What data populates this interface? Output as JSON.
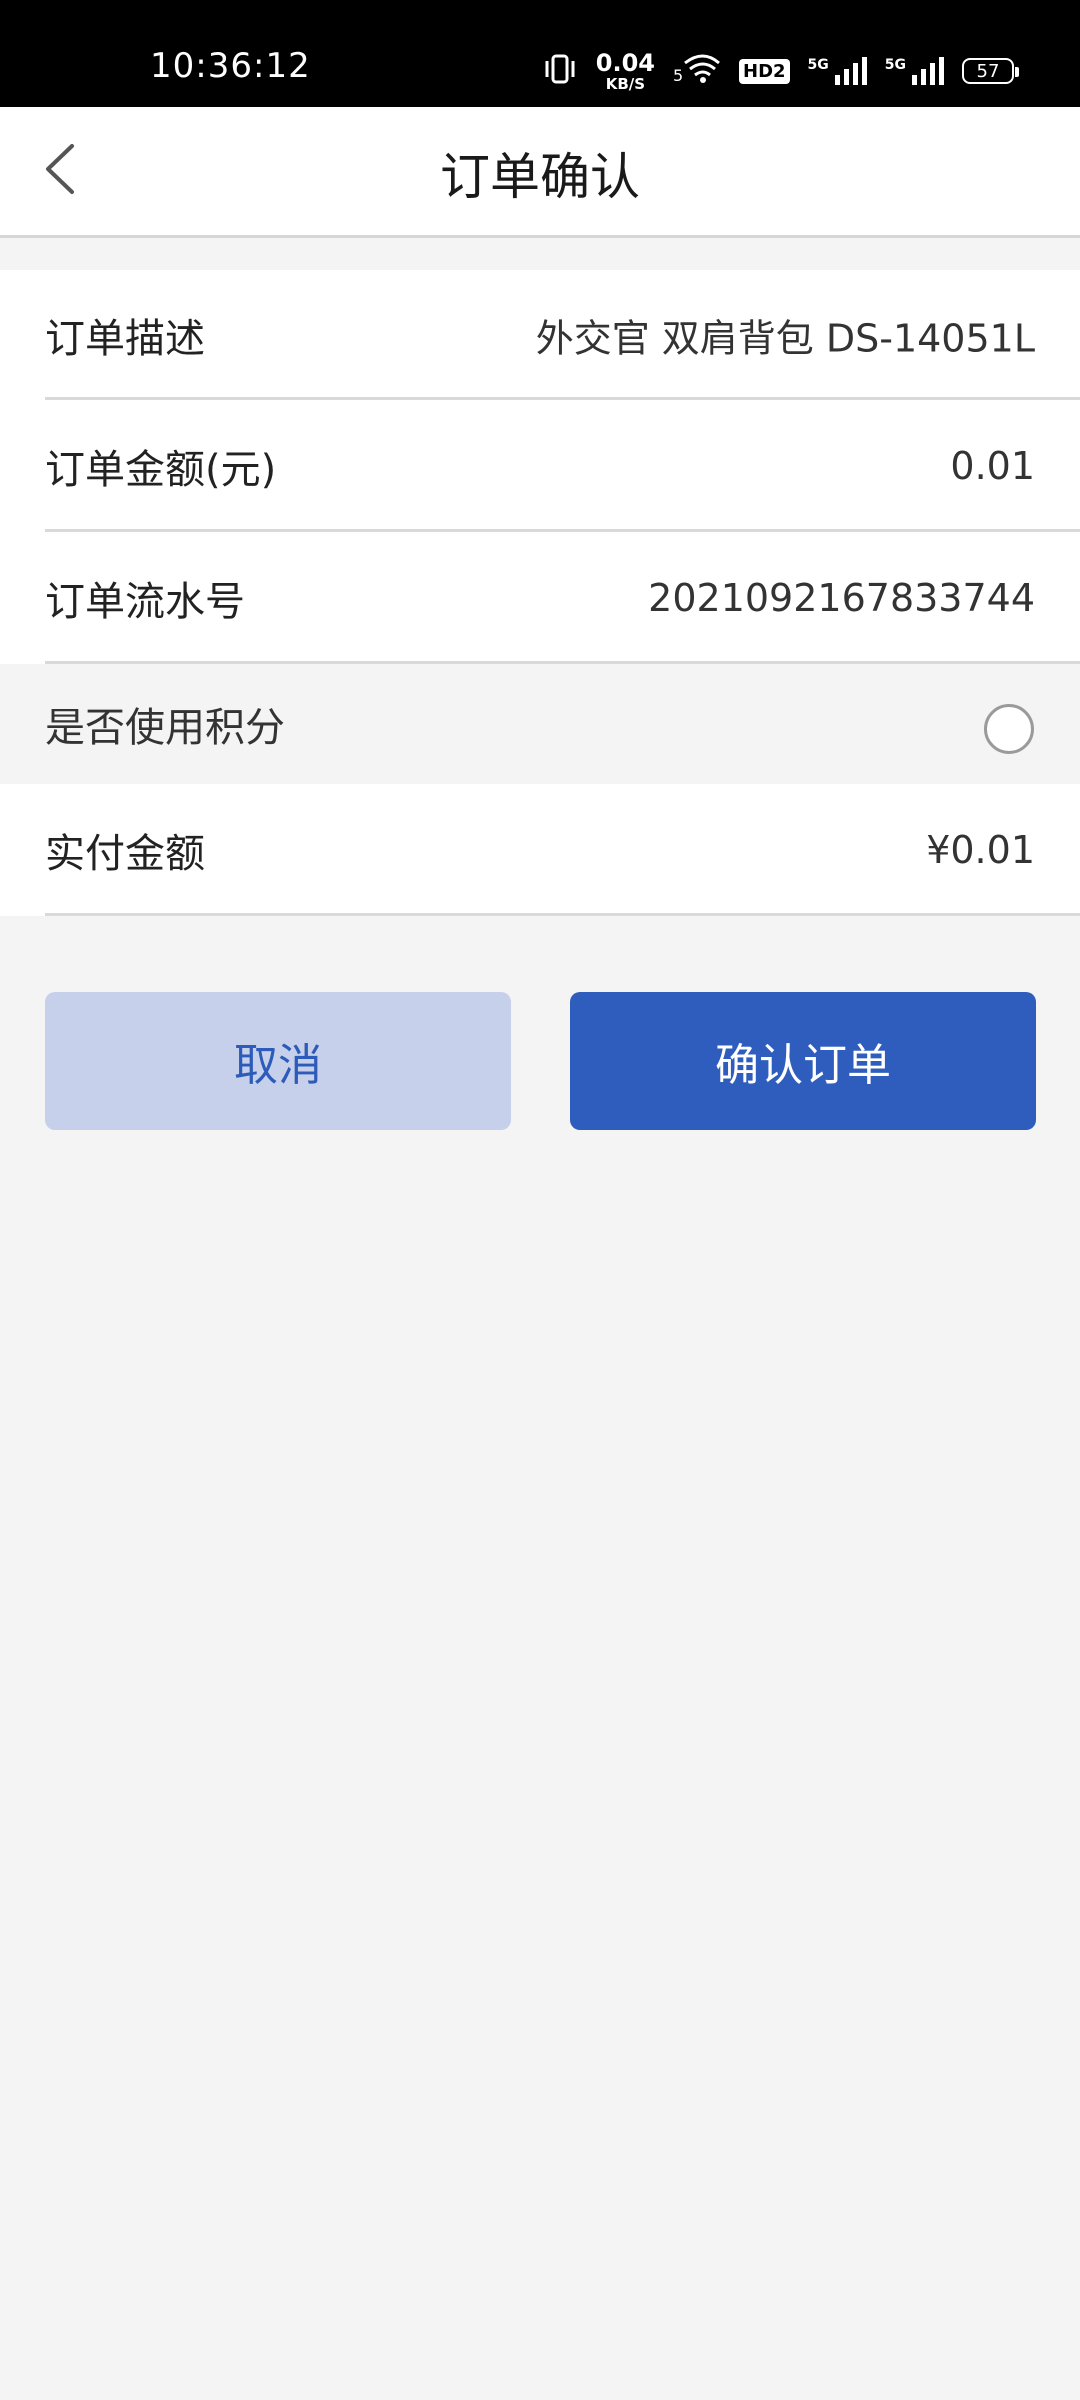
{
  "status_bar": {
    "time": "10:36:12",
    "net_speed_value": "0.04",
    "net_speed_unit": "KB/S",
    "hd_badge": "HD2",
    "sim1_label": "5G",
    "sim2_label": "5G",
    "battery_level": "57"
  },
  "header": {
    "title": "订单确认"
  },
  "order": {
    "desc_label": "订单描述",
    "desc_value": "外交官 双肩背包 DS-14051L",
    "amount_label": "订单金额(元)",
    "amount_value": "0.01",
    "serial_label": "订单流水号",
    "serial_value": "2021092167833744",
    "points_label": "是否使用积分",
    "pay_label": "实付金额",
    "pay_value": "¥0.01"
  },
  "actions": {
    "cancel_label": "取消",
    "confirm_label": "确认订单"
  },
  "colors": {
    "accent": "#2f5dbd",
    "cancel_bg": "#c6d0ea",
    "page_bg": "#f4f4f5"
  }
}
